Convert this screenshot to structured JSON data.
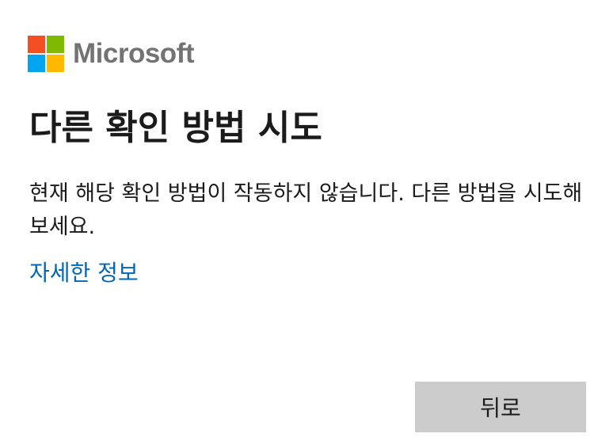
{
  "brand": {
    "name": "Microsoft",
    "logo_icon": "microsoft-logo-icon",
    "logo_colors": [
      "#f25022",
      "#7fba00",
      "#00a4ef",
      "#ffb900"
    ]
  },
  "content": {
    "title": "다른 확인 방법 시도",
    "description": "현재 해당 확인 방법이 작동하지 않습니다. 다른 방법을 시도해 보세요.",
    "more_info_link": "자세한 정보"
  },
  "actions": {
    "back_label": "뒤로"
  },
  "colors": {
    "link": "#0067b8",
    "button_bg": "#cccccc",
    "text": "#1b1b1b",
    "brand_text": "#737373"
  }
}
